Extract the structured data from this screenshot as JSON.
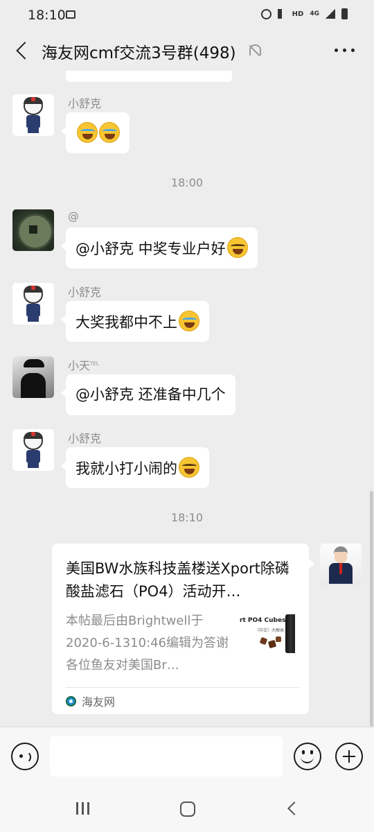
{
  "status_bar": {
    "time": "18:10",
    "network_hd": "HD",
    "network_4g": "4G"
  },
  "header": {
    "title": "海友网cmf交流3号群(498)"
  },
  "timestamps": [
    "18:00",
    "18:10"
  ],
  "messages": [
    {
      "sender": "小舒克",
      "text": "",
      "emoji_count": 2
    },
    {
      "sender": "@",
      "text": "@小舒克  中奖专业户好"
    },
    {
      "sender": "小舒克",
      "text": "大奖我都中不上"
    },
    {
      "sender": "小天",
      "sender_suffix": "TEL",
      "text": "@小舒克  还准备中几个"
    },
    {
      "sender": "小舒克",
      "text": "我就小打小闹的"
    }
  ],
  "link_card": {
    "title": "美国BW水族科技盖楼送Xport除磷酸盐滤石（PO4）活动开…",
    "description": "本帖最后由Brightwell于2020-6-1310:46编辑为答谢各位鱼友对美国Br…",
    "thumb_title": "rt PO4 Cubes",
    "thumb_subtitle": "（中文）大鲵米",
    "source": "海友网"
  },
  "colors": {
    "background": "#ededed",
    "bubble": "#ffffff",
    "meta_text": "#8c8c8c"
  }
}
